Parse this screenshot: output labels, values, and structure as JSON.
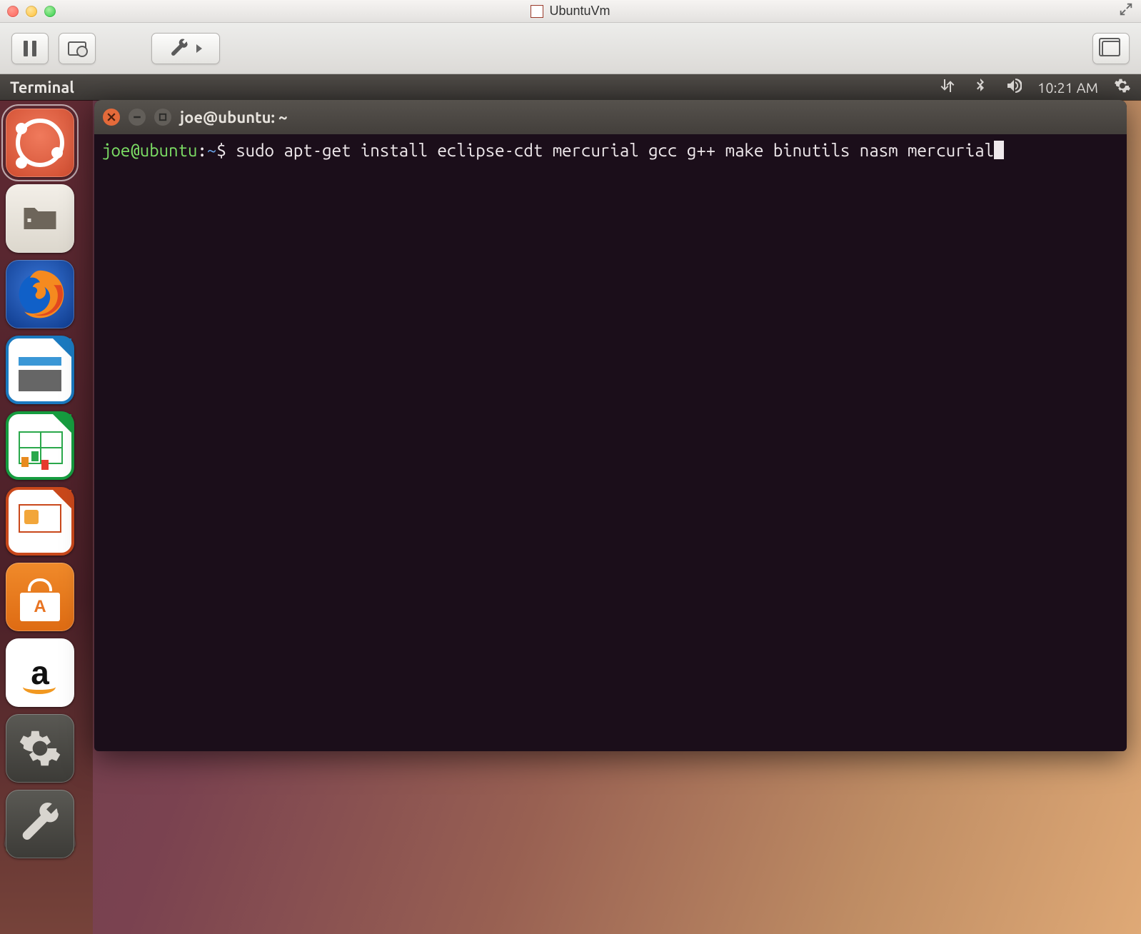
{
  "host": {
    "window_title": "UbuntuVm"
  },
  "ubuntu_panel": {
    "active_app": "Terminal",
    "clock": "10:21 AM"
  },
  "launcher": {
    "items": [
      {
        "name": "dash"
      },
      {
        "name": "files"
      },
      {
        "name": "firefox"
      },
      {
        "name": "libreoffice-writer"
      },
      {
        "name": "libreoffice-calc"
      },
      {
        "name": "libreoffice-impress"
      },
      {
        "name": "software-center"
      },
      {
        "name": "amazon"
      },
      {
        "name": "system-settings"
      },
      {
        "name": "terminal"
      },
      {
        "name": "software-updater"
      }
    ]
  },
  "terminal": {
    "title": "joe@ubuntu: ~",
    "prompt_userhost": "joe@ubuntu",
    "prompt_sep": ":",
    "prompt_path": "~",
    "prompt_suffix": "$ ",
    "command": "sudo apt-get install eclipse-cdt mercurial gcc g++ make binutils nasm mercurial"
  }
}
